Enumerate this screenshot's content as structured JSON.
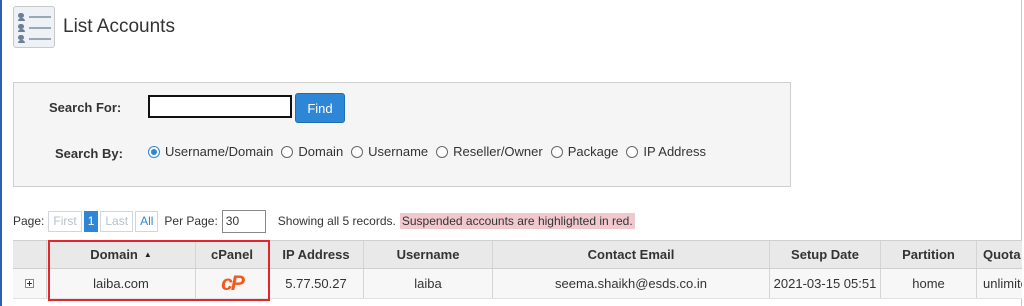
{
  "page": {
    "title": "List Accounts"
  },
  "search": {
    "for_label": "Search For:",
    "value": "",
    "find_label": "Find",
    "by_label": "Search By:",
    "options": [
      "Username/Domain",
      "Domain",
      "Username",
      "Reseller/Owner",
      "Package",
      "IP Address"
    ],
    "selected": "Username/Domain"
  },
  "pager": {
    "page_label": "Page:",
    "first": "First",
    "current": "1",
    "last": "Last",
    "all": "All",
    "per_page_label": "Per Page:",
    "per_page_value": "30",
    "showing": "Showing all 5 records.",
    "suspended_note": "Suspended accounts are highlighted in red."
  },
  "table": {
    "headers": [
      "Domain",
      "cPanel",
      "IP Address",
      "Username",
      "Contact Email",
      "Setup Date",
      "Partition",
      "Quota"
    ],
    "sort_indicator": "▲",
    "rows": [
      {
        "domain": "laiba.com",
        "cpanel_logo": "cP",
        "ip": "5.77.50.27",
        "username": "laiba",
        "email": "seema.shaikh@esds.co.in",
        "setup_date": "2021-03-15 05:51",
        "partition": "home",
        "quota": "unlimited"
      }
    ]
  },
  "colors": {
    "accent": "#2e86d6",
    "suspended_bg": "#f2c8cf",
    "highlight_border": "#e2262d",
    "cpanel_orange": "#f4581f"
  }
}
